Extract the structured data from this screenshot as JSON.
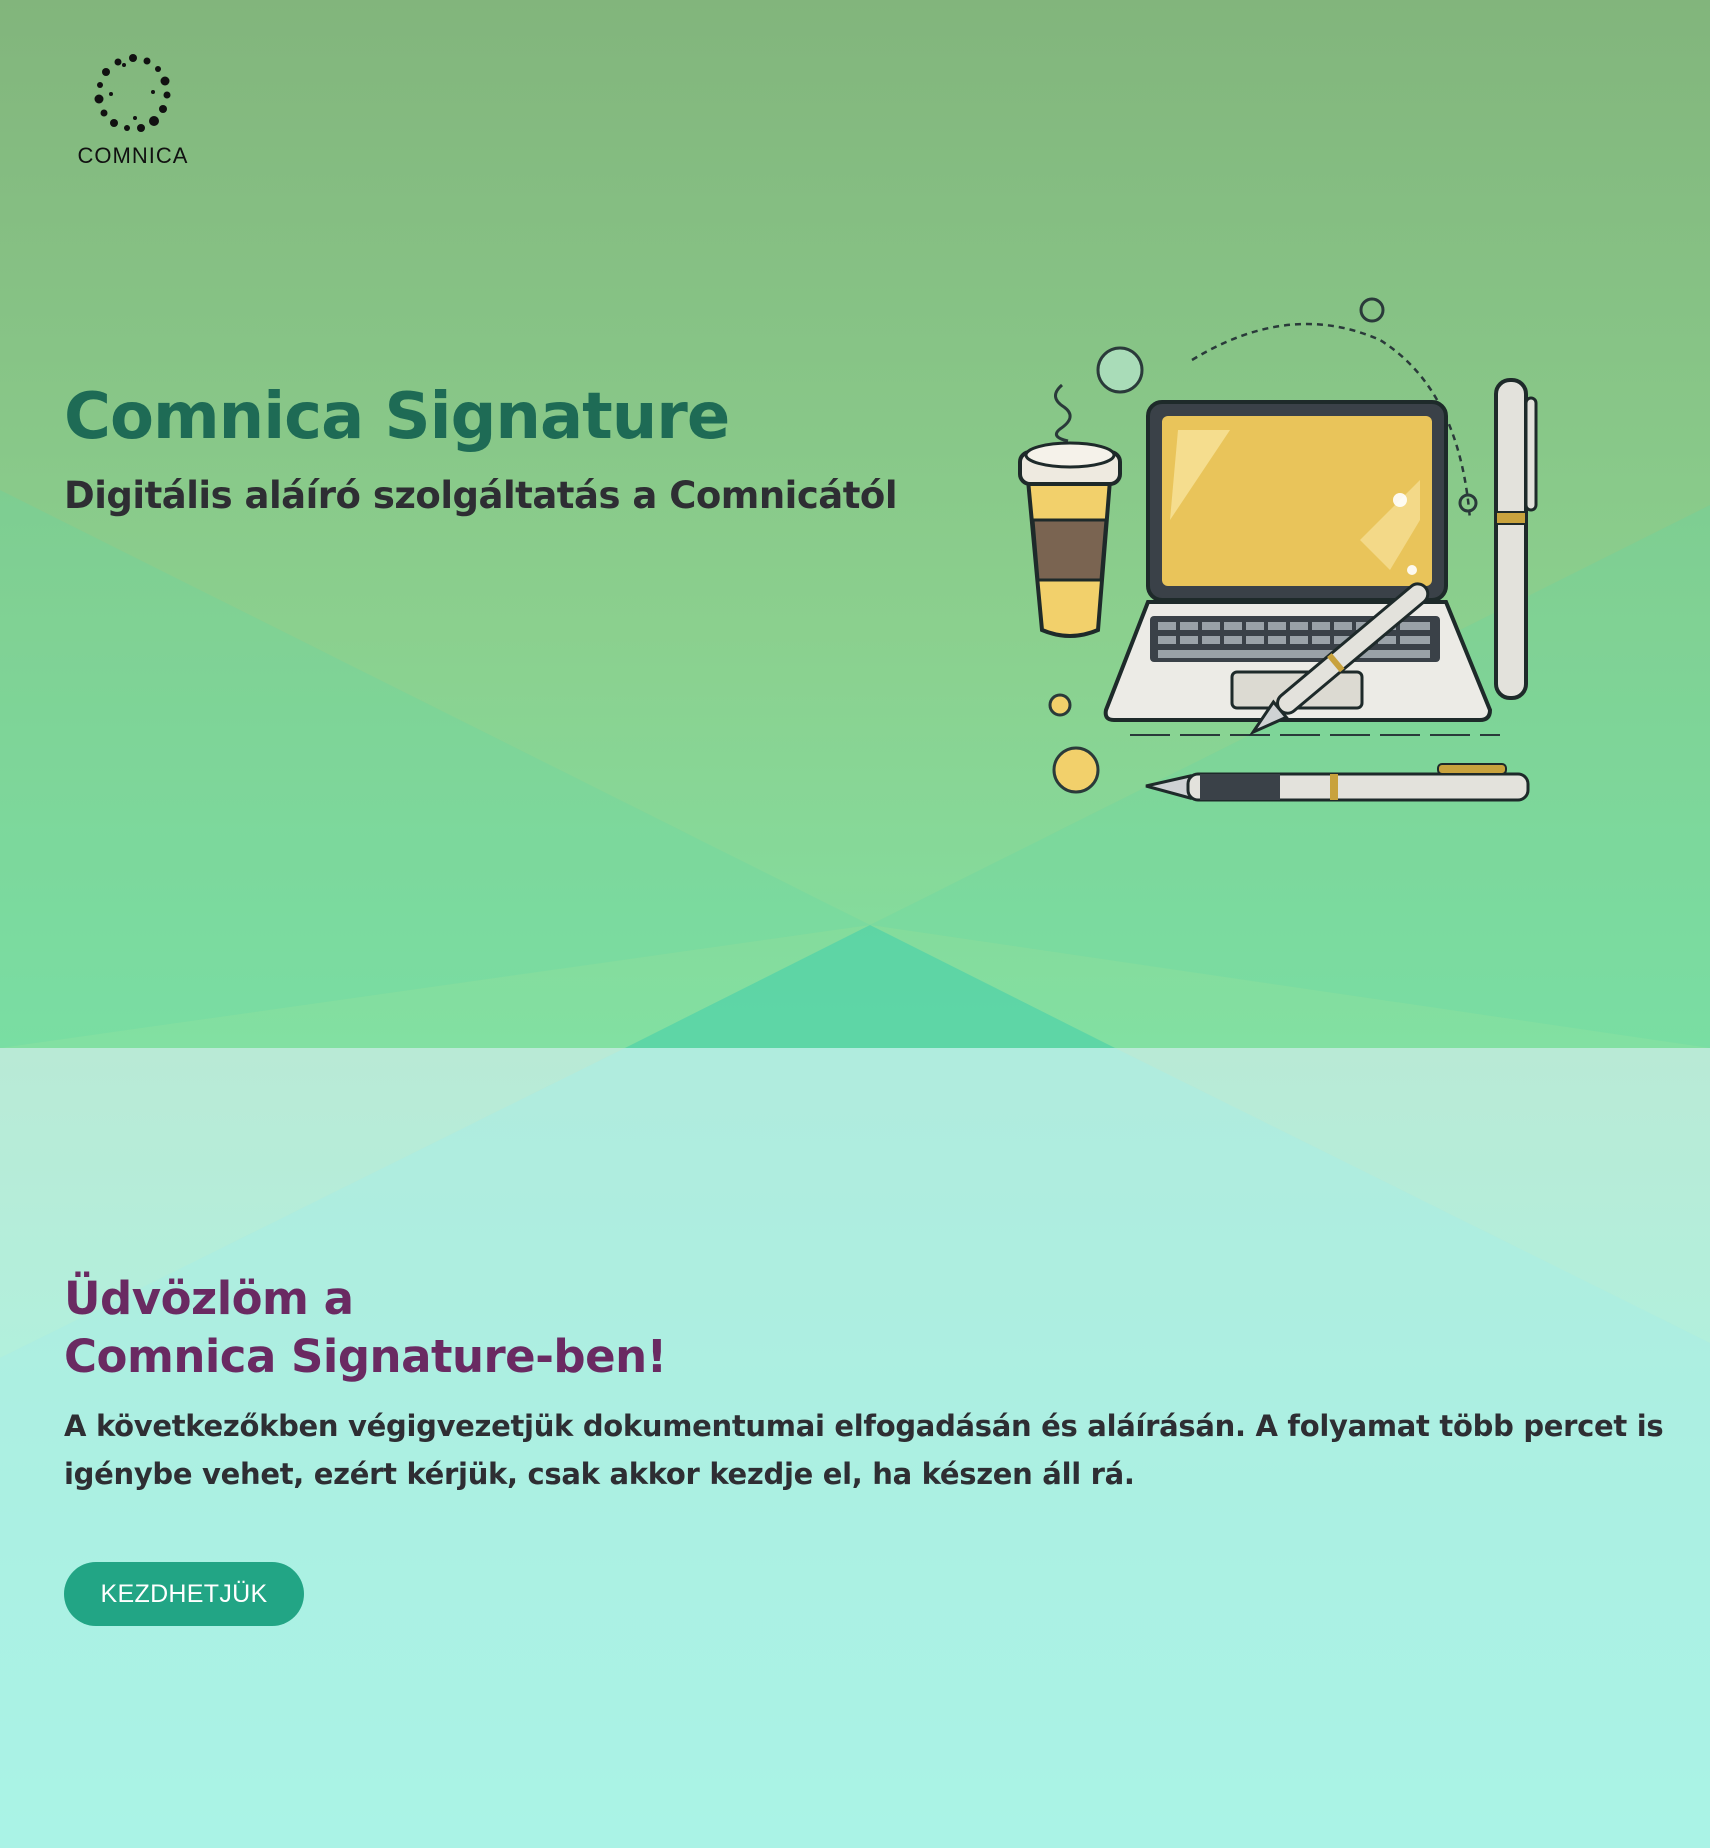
{
  "brand": {
    "logo_text": "COMNICA",
    "logo_icon": "dotted-circle-logo"
  },
  "hero": {
    "title": "Comnica Signature",
    "subtitle": "Digitális aláíró szolgáltatás a Comnicától",
    "illustration": "laptop-coffee-pens-illustration"
  },
  "welcome": {
    "heading_line1": "Üdvözlöm a",
    "heading_line2": "Comnica Signature-ben!",
    "body": "A következőkben végigvezetjük dokumentumai elfogadásán és aláírásán. A folyamat több percet is igénybe vehet, ezért kérjük, csak akkor kezdje el, ha készen áll rá.",
    "button_label": "KEZDHETJÜK"
  },
  "colors": {
    "title": "#1e6b55",
    "welcome_heading": "#6a2a62",
    "button": "#22a585",
    "hero_bg": "#8bd08e",
    "lower_bg": "#aef3e0"
  }
}
